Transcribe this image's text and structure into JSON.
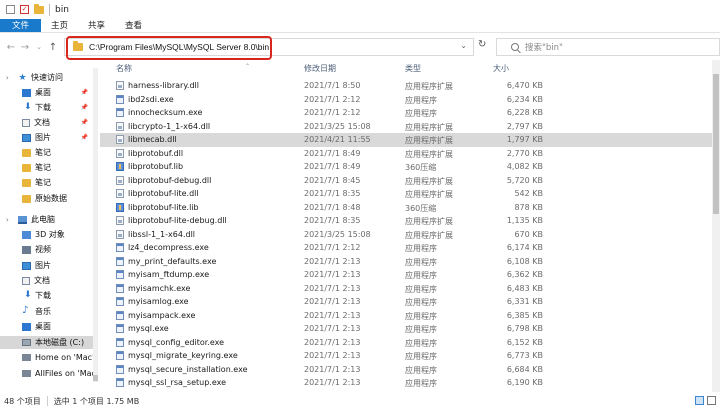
{
  "window": {
    "title": "bin"
  },
  "ribbon": {
    "tabs": [
      "文件",
      "主页",
      "共享",
      "查看"
    ]
  },
  "address": {
    "path": "C:\\Program Files\\MySQL\\MySQL Server 8.0\\bin"
  },
  "search": {
    "placeholder": "搜索\"bin\""
  },
  "columns": {
    "name": "名称",
    "date": "修改日期",
    "type": "类型",
    "size": "大小"
  },
  "sidebar": [
    {
      "label": "快速访问",
      "icon": "star-icon"
    },
    {
      "label": "桌面",
      "icon": "desktop-icon",
      "pinned": true
    },
    {
      "label": "下载",
      "icon": "download-icon",
      "pinned": true
    },
    {
      "label": "文档",
      "icon": "document-icon",
      "pinned": true
    },
    {
      "label": "图片",
      "icon": "picture-icon",
      "pinned": true
    },
    {
      "label": "笔记",
      "icon": "folder-icon"
    },
    {
      "label": "笔记",
      "icon": "folder-icon"
    },
    {
      "label": "笔记",
      "icon": "folder-icon"
    },
    {
      "label": "原始数据",
      "icon": "folder-icon"
    },
    {
      "label": "此电脑",
      "icon": "computer-icon"
    },
    {
      "label": "3D 对象",
      "icon": "3d-objects-icon"
    },
    {
      "label": "视频",
      "icon": "video-icon"
    },
    {
      "label": "图片",
      "icon": "picture-icon"
    },
    {
      "label": "文档",
      "icon": "document-icon"
    },
    {
      "label": "下载",
      "icon": "download-icon"
    },
    {
      "label": "音乐",
      "icon": "music-icon"
    },
    {
      "label": "桌面",
      "icon": "desktop-icon"
    },
    {
      "label": "本地磁盘 (C:)",
      "icon": "disk-icon",
      "selected": true
    },
    {
      "label": "Home on 'Mac'",
      "icon": "network-drive-icon"
    },
    {
      "label": "AllFiles on 'Mac'",
      "icon": "network-drive-icon"
    }
  ],
  "files": [
    {
      "name": "harness-library.dll",
      "date": "2021/7/1 8:50",
      "type": "应用程序扩展",
      "size": "6,470 KB",
      "kind": "dll"
    },
    {
      "name": "ibd2sdi.exe",
      "date": "2021/7/1 2:12",
      "type": "应用程序",
      "size": "6,234 KB",
      "kind": "exe"
    },
    {
      "name": "innochecksum.exe",
      "date": "2021/7/1 2:12",
      "type": "应用程序",
      "size": "6,228 KB",
      "kind": "exe"
    },
    {
      "name": "libcrypto-1_1-x64.dll",
      "date": "2021/3/25 15:08",
      "type": "应用程序扩展",
      "size": "2,797 KB",
      "kind": "dll"
    },
    {
      "name": "libmecab.dll",
      "date": "2021/4/21 11:55",
      "type": "应用程序扩展",
      "size": "1,797 KB",
      "kind": "dll",
      "selected": true
    },
    {
      "name": "libprotobuf.dll",
      "date": "2021/7/1 8:49",
      "type": "应用程序扩展",
      "size": "2,770 KB",
      "kind": "dll"
    },
    {
      "name": "libprotobuf.lib",
      "date": "2021/7/1 8:49",
      "type": "360压缩",
      "size": "4,082 KB",
      "kind": "lib"
    },
    {
      "name": "libprotobuf-debug.dll",
      "date": "2021/7/1 8:45",
      "type": "应用程序扩展",
      "size": "5,720 KB",
      "kind": "dll"
    },
    {
      "name": "libprotobuf-lite.dll",
      "date": "2021/7/1 8:35",
      "type": "应用程序扩展",
      "size": "542 KB",
      "kind": "dll"
    },
    {
      "name": "libprotobuf-lite.lib",
      "date": "2021/7/1 8:48",
      "type": "360压缩",
      "size": "878 KB",
      "kind": "lib"
    },
    {
      "name": "libprotobuf-lite-debug.dll",
      "date": "2021/7/1 8:35",
      "type": "应用程序扩展",
      "size": "1,135 KB",
      "kind": "dll"
    },
    {
      "name": "libssl-1_1-x64.dll",
      "date": "2021/3/25 15:08",
      "type": "应用程序扩展",
      "size": "670 KB",
      "kind": "dll"
    },
    {
      "name": "lz4_decompress.exe",
      "date": "2021/7/1 2:12",
      "type": "应用程序",
      "size": "6,174 KB",
      "kind": "exe"
    },
    {
      "name": "my_print_defaults.exe",
      "date": "2021/7/1 2:13",
      "type": "应用程序",
      "size": "6,108 KB",
      "kind": "exe"
    },
    {
      "name": "myisam_ftdump.exe",
      "date": "2021/7/1 2:13",
      "type": "应用程序",
      "size": "6,362 KB",
      "kind": "exe"
    },
    {
      "name": "myisamchk.exe",
      "date": "2021/7/1 2:13",
      "type": "应用程序",
      "size": "6,483 KB",
      "kind": "exe"
    },
    {
      "name": "myisamlog.exe",
      "date": "2021/7/1 2:13",
      "type": "应用程序",
      "size": "6,331 KB",
      "kind": "exe"
    },
    {
      "name": "myisampack.exe",
      "date": "2021/7/1 2:13",
      "type": "应用程序",
      "size": "6,385 KB",
      "kind": "exe"
    },
    {
      "name": "mysql.exe",
      "date": "2021/7/1 2:13",
      "type": "应用程序",
      "size": "6,798 KB",
      "kind": "exe"
    },
    {
      "name": "mysql_config_editor.exe",
      "date": "2021/7/1 2:13",
      "type": "应用程序",
      "size": "6,152 KB",
      "kind": "exe"
    },
    {
      "name": "mysql_migrate_keyring.exe",
      "date": "2021/7/1 2:13",
      "type": "应用程序",
      "size": "6,773 KB",
      "kind": "exe"
    },
    {
      "name": "mysql_secure_installation.exe",
      "date": "2021/7/1 2:13",
      "type": "应用程序",
      "size": "6,684 KB",
      "kind": "exe"
    },
    {
      "name": "mysql_ssl_rsa_setup.exe",
      "date": "2021/7/1 2:13",
      "type": "应用程序",
      "size": "6,190 KB",
      "kind": "exe"
    }
  ],
  "status": {
    "count": "48 个项目",
    "selection": "选中 1 个项目  1.75 MB"
  }
}
